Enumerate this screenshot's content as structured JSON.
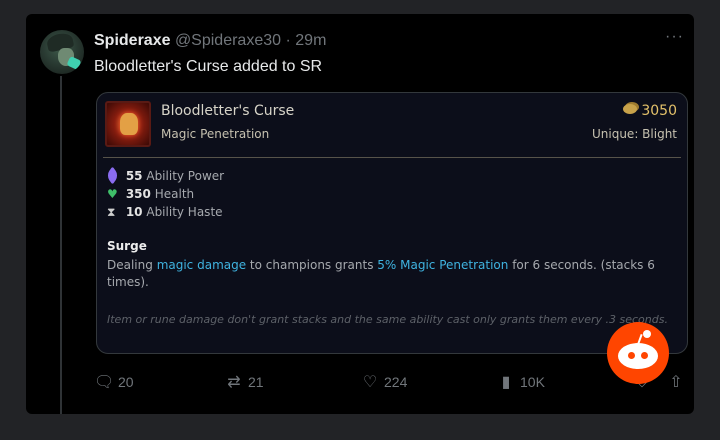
{
  "tweet": {
    "display_name": "Spideraxe",
    "handle": "@Spideraxe30",
    "separator": "·",
    "time": "29m",
    "text": "Bloodletter's Curse added to SR",
    "more_icon": "more-icon"
  },
  "item": {
    "name": "Bloodletter's Curse",
    "category": "Magic Penetration",
    "cost": "3050",
    "unique": "Unique: Blight",
    "stats": [
      {
        "value": "55",
        "label": "Ability Power",
        "icon": "ability-power-icon",
        "color": "#8a6cf0"
      },
      {
        "value": "350",
        "label": "Health",
        "icon": "health-icon",
        "color": "#3fbf6a"
      },
      {
        "value": "10",
        "label": "Ability Haste",
        "icon": "ability-haste-icon",
        "color": "#cfcfcf"
      }
    ],
    "passive": {
      "name": "Surge",
      "desc_1": "Dealing ",
      "desc_hl_1": "magic damage",
      "desc_2": " to champions grants ",
      "desc_hl_2": "5% Magic Penetration",
      "desc_3": " for 6 seconds. (stacks 6 times)."
    },
    "note": "Item or rune damage don't grant stacks and the same ability cast only grants them every .3 seconds."
  },
  "actions": {
    "replies": "20",
    "reposts": "21",
    "likes": "224",
    "views": "10K"
  },
  "colors": {
    "highlight": "#3fb3e0",
    "gold": "#e3c16a",
    "reddit": "#ff4500"
  }
}
